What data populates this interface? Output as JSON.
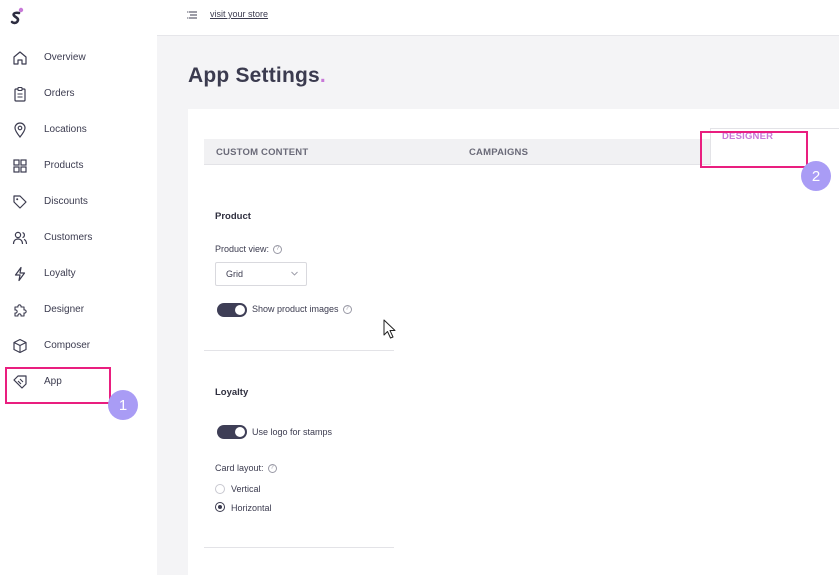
{
  "sidebar": {
    "logo_icon": "brand-s-logo",
    "items": [
      {
        "label": "Overview",
        "icon": "home-icon"
      },
      {
        "label": "Orders",
        "icon": "clipboard-icon"
      },
      {
        "label": "Locations",
        "icon": "location-pin-icon"
      },
      {
        "label": "Products",
        "icon": "grid-icon"
      },
      {
        "label": "Discounts",
        "icon": "tag-icon"
      },
      {
        "label": "Customers",
        "icon": "users-icon"
      },
      {
        "label": "Loyalty",
        "icon": "lightning-icon"
      },
      {
        "label": "Designer",
        "icon": "puzzle-icon"
      },
      {
        "label": "Composer",
        "icon": "box-icon"
      },
      {
        "label": "App",
        "icon": "app-tag-icon"
      }
    ]
  },
  "topbar": {
    "menu_icon": "menu-icon",
    "store_link": "visit your store"
  },
  "page": {
    "title": "App Settings",
    "title_dot": "."
  },
  "tabs": [
    {
      "label": "CUSTOM CONTENT",
      "active": false
    },
    {
      "label": "CAMPAIGNS",
      "active": false
    },
    {
      "label": "DESIGNER",
      "active": true
    }
  ],
  "annotations": {
    "step1": "1",
    "step2": "2",
    "highlight_color": "#e91e7f",
    "badge_color": "#a99cf5"
  },
  "product_section": {
    "title": "Product",
    "view_label": "Product view:",
    "view_value": "Grid",
    "show_images_label": "Show product images",
    "show_images_on": true
  },
  "loyalty_section": {
    "title": "Loyalty",
    "logo_stamps_label": "Use logo for stamps",
    "logo_stamps_on": true,
    "card_layout_label": "Card layout:",
    "options": [
      {
        "label": "Vertical",
        "checked": false
      },
      {
        "label": "Horizontal",
        "checked": true
      }
    ]
  },
  "colors": {
    "accent": "#c879d8",
    "toggle_on": "#3e3e56"
  }
}
